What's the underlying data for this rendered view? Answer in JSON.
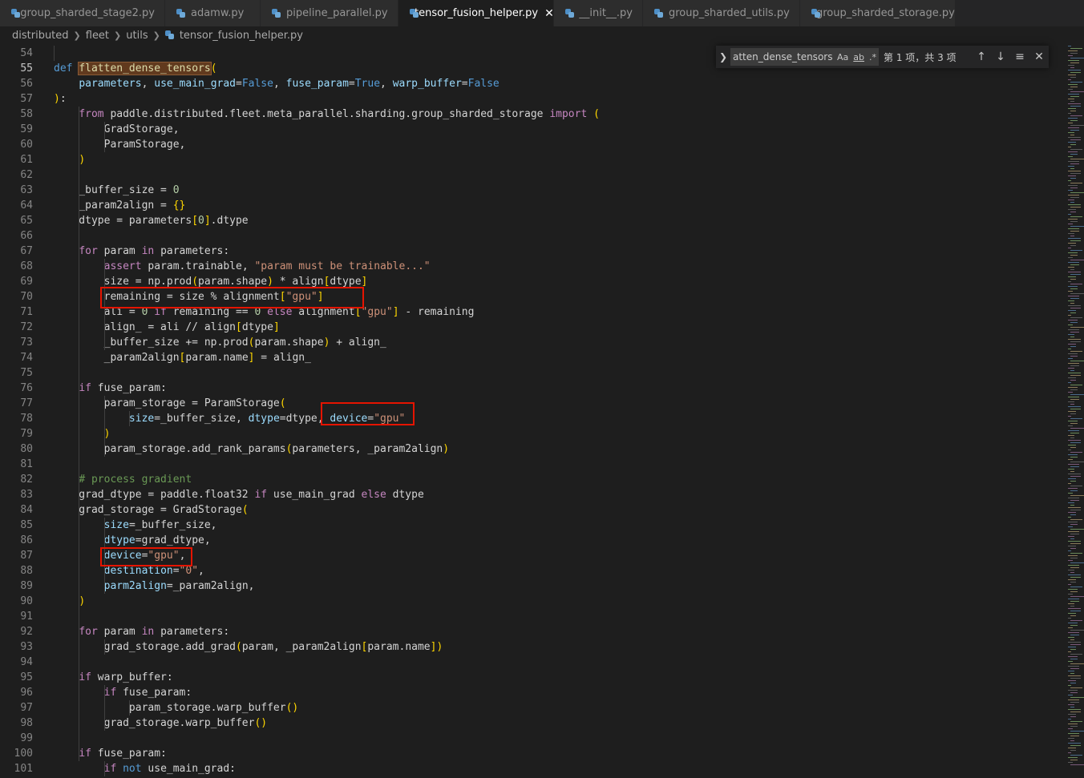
{
  "tabs": [
    {
      "label": "group_sharded_stage2.py",
      "active": false
    },
    {
      "label": "adamw.py",
      "active": false
    },
    {
      "label": "pipeline_parallel.py",
      "active": false
    },
    {
      "label": "tensor_fusion_helper.py",
      "active": true
    },
    {
      "label": "__init__.py",
      "active": false
    },
    {
      "label": "group_sharded_utils.py",
      "active": false
    },
    {
      "label": "group_sharded_storage.py",
      "active": false
    }
  ],
  "breadcrumb": [
    "distributed",
    "fleet",
    "utils",
    "tensor_fusion_helper.py"
  ],
  "find": {
    "query": "atten_dense_tensors",
    "match_case": "Aa",
    "whole_word": "ab",
    "regex": ".*",
    "result": "第 1 项，共 3 项"
  },
  "lines": [
    {
      "n": "54",
      "html": ""
    },
    {
      "n": "55",
      "html": "<span class=\"kw\">def</span> <span class=\"fn hl\">flatten_dense_tensors</span><span class=\"br1\">(</span>"
    },
    {
      "n": "56",
      "html": "    <span class=\"prm\">parameters</span>, <span class=\"prm\">use_main_grad</span>=<span class=\"kw\">False</span>, <span class=\"prm\">fuse_param</span>=<span class=\"kw\">True</span>, <span class=\"prm\">warp_buffer</span>=<span class=\"kw\">False</span>"
    },
    {
      "n": "57",
      "html": "<span class=\"br1\">)</span>:"
    },
    {
      "n": "58",
      "html": "    <span class=\"ctl\">from</span> paddle.distributed.fleet.meta_parallel.sharding.group_sharded_storage <span class=\"ctl\">import</span> <span class=\"br1\">(</span>"
    },
    {
      "n": "59",
      "html": "        GradStorage,"
    },
    {
      "n": "60",
      "html": "        ParamStorage,"
    },
    {
      "n": "61",
      "html": "    <span class=\"br1\">)</span>"
    },
    {
      "n": "62",
      "html": ""
    },
    {
      "n": "63",
      "html": "    _buffer_size = <span class=\"num\">0</span>"
    },
    {
      "n": "64",
      "html": "    _param2align = <span class=\"br1\">{}</span>"
    },
    {
      "n": "65",
      "html": "    dtype = parameters<span class=\"br1\">[</span><span class=\"num\">0</span><span class=\"br1\">]</span>.dtype"
    },
    {
      "n": "66",
      "html": ""
    },
    {
      "n": "67",
      "html": "    <span class=\"ctl\">for</span> param <span class=\"ctl\">in</span> parameters:"
    },
    {
      "n": "68",
      "html": "        <span class=\"ctl\">assert</span> param.trainable, <span class=\"str\">\"param must be trainable...\"</span>"
    },
    {
      "n": "69",
      "html": "        size = np.prod<span class=\"br1\">(</span>param.shape<span class=\"br1\">)</span> * align<span class=\"br1\">[</span>dtype<span class=\"br1\">]</span>"
    },
    {
      "n": "70",
      "html": "        remaining = size % alignment<span class=\"br1\">[</span><span class=\"str\">\"gpu\"</span><span class=\"br1\">]</span>"
    },
    {
      "n": "71",
      "html": "        ali = <span class=\"num\">0</span> <span class=\"ctl\">if</span> remaining == <span class=\"num\">0</span> <span class=\"ctl\">else</span> alignment<span class=\"br1\">[</span><span class=\"str\">\"gpu\"</span><span class=\"br1\">]</span> - remaining"
    },
    {
      "n": "72",
      "html": "        align_ = ali // align<span class=\"br1\">[</span>dtype<span class=\"br1\">]</span>"
    },
    {
      "n": "73",
      "html": "        _buffer_size += np.prod<span class=\"br1\">(</span>param.shape<span class=\"br1\">)</span> + align_"
    },
    {
      "n": "74",
      "html": "        _param2align<span class=\"br1\">[</span>param.name<span class=\"br1\">]</span> = align_"
    },
    {
      "n": "75",
      "html": ""
    },
    {
      "n": "76",
      "html": "    <span class=\"ctl\">if</span> fuse_param:"
    },
    {
      "n": "77",
      "html": "        param_storage = ParamStorage<span class=\"br1\">(</span>"
    },
    {
      "n": "78",
      "html": "            <span class=\"prm\">size</span>=_buffer_size, <span class=\"prm\">dtype</span>=dtype, <span class=\"prm\">device</span>=<span class=\"str\">\"gpu\"</span>"
    },
    {
      "n": "79",
      "html": "        <span class=\"br1\">)</span>"
    },
    {
      "n": "80",
      "html": "        param_storage.add_rank_params<span class=\"br1\">(</span>parameters, _param2align<span class=\"br1\">)</span>"
    },
    {
      "n": "81",
      "html": ""
    },
    {
      "n": "82",
      "html": "    <span class=\"cmt\"># process gradient</span>"
    },
    {
      "n": "83",
      "html": "    grad_dtype = paddle.float32 <span class=\"ctl\">if</span> use_main_grad <span class=\"ctl\">else</span> dtype"
    },
    {
      "n": "84",
      "html": "    grad_storage = GradStorage<span class=\"br1\">(</span>"
    },
    {
      "n": "85",
      "html": "        <span class=\"prm\">size</span>=_buffer_size,"
    },
    {
      "n": "86",
      "html": "        <span class=\"prm\">dtype</span>=grad_dtype,"
    },
    {
      "n": "87",
      "html": "        <span class=\"prm\">device</span>=<span class=\"str\">\"gpu\"</span>,"
    },
    {
      "n": "88",
      "html": "        <span class=\"prm\">destination</span>=<span class=\"str\">\"0\"</span>,"
    },
    {
      "n": "89",
      "html": "        <span class=\"prm\">parm2align</span>=_param2align,"
    },
    {
      "n": "90",
      "html": "    <span class=\"br1\">)</span>"
    },
    {
      "n": "91",
      "html": ""
    },
    {
      "n": "92",
      "html": "    <span class=\"ctl\">for</span> param <span class=\"ctl\">in</span> parameters:"
    },
    {
      "n": "93",
      "html": "        grad_storage.add_grad<span class=\"br1\">(</span>param, _param2align<span class=\"br1\">[</span>param.name<span class=\"br1\">])</span>"
    },
    {
      "n": "94",
      "html": ""
    },
    {
      "n": "95",
      "html": "    <span class=\"ctl\">if</span> warp_buffer:"
    },
    {
      "n": "96",
      "html": "        <span class=\"ctl\">if</span> fuse_param:"
    },
    {
      "n": "97",
      "html": "            param_storage.warp_buffer<span class=\"br1\">()</span>"
    },
    {
      "n": "98",
      "html": "        grad_storage.warp_buffer<span class=\"br1\">()</span>"
    },
    {
      "n": "99",
      "html": ""
    },
    {
      "n": "100",
      "html": "    <span class=\"ctl\">if</span> fuse_param:"
    },
    {
      "n": "101",
      "html": "        <span class=\"ctl\">if</span> <span class=\"kw\">not</span> use_main_grad:"
    }
  ],
  "active_line": "55",
  "colors": {
    "background": "#1e1e1e",
    "tab_bar": "#252526",
    "highlight_box": "#e51400"
  }
}
